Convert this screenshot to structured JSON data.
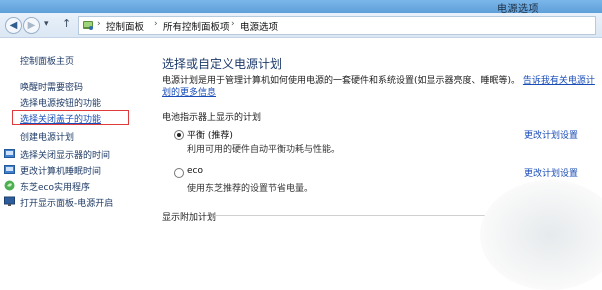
{
  "window": {
    "title": "电源选项"
  },
  "nav": {
    "back_glyph": "◀",
    "forward_glyph": "▶",
    "history_glyph": "▾",
    "up_glyph": "↑"
  },
  "breadcrumb": {
    "items": [
      "控制面板",
      "所有控制面板项",
      "电源选项"
    ],
    "separator": "›"
  },
  "sidebar": {
    "home_label": "控制面板主页",
    "items": [
      {
        "label": "唤醒时需要密码"
      },
      {
        "label": "选择电源按钮的功能"
      },
      {
        "label": "选择关闭盖子的功能",
        "highlighted": true
      },
      {
        "label": "创建电源计划"
      },
      {
        "label": "选择关闭显示器的时间",
        "icon": "power-plan-icon"
      },
      {
        "label": "更改计算机睡眠时间",
        "icon": "power-plan-icon"
      },
      {
        "label": "东芝eco实用程序",
        "icon": "eco-icon"
      },
      {
        "label": "打开显示面板-电源开启",
        "icon": "display-icon"
      }
    ]
  },
  "main": {
    "heading": "选择或自定义电源计划",
    "description": "电源计划是用于管理计算机如何使用电源的一套硬件和系统设置(如显示器亮度、睡眠等)。",
    "description_link": "告诉我有关电源计划的更多信息",
    "battery_section_title": "电池指示器上显示的计划",
    "plans": [
      {
        "name": "平衡 (推荐)",
        "description": "利用可用的硬件自动平衡功耗与性能。",
        "selected": true,
        "change_link": "更改计划设置"
      },
      {
        "name": "eco",
        "description": "使用东芝推荐的设置节省电量。",
        "selected": false,
        "change_link": "更改计划设置"
      }
    ],
    "more_plans_title": "显示附加计划",
    "expand_glyph": "⌄"
  },
  "colors": {
    "highlight_border": "#e03b3b",
    "link": "#1a4db8",
    "heading": "#1d3a6b"
  }
}
